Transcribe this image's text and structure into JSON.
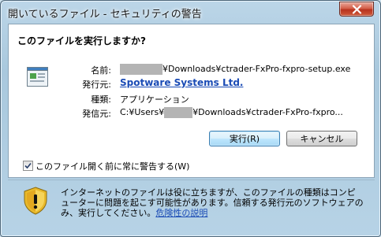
{
  "window": {
    "title": "開いているファイル - セキュリティの警告",
    "close_icon": "close-x-icon"
  },
  "dialog": {
    "question": "このファイルを実行しますか?",
    "file_icon": "executable-file-icon",
    "details": {
      "name_label": "名前:",
      "name_value": "¥Downloads¥ctrader-FxPro-fxpro-setup.exe",
      "publisher_label": "発行元:",
      "publisher_value": "Spotware Systems Ltd.",
      "type_label": "種類:",
      "type_value": "アプリケーション",
      "from_label": "発信元:",
      "from_prefix": "C:¥Users¥",
      "from_suffix": "¥Downloads¥ctrader-FxPro-fxpro..."
    },
    "buttons": {
      "run": "実行(R)",
      "cancel": "キャンセル"
    },
    "checkbox": {
      "label": "このファイル開く前に常に警告する(W)",
      "checked": true
    },
    "warning": {
      "icon": "shield-warning-icon",
      "text": "インターネットのファイルは役に立ちますが、このファイルの種類はコンピューターに問題を起こす可能性があります。信頼する発行元のソフトウェアのみ、実行してください。",
      "link": "危険性の説明"
    }
  },
  "colors": {
    "link": "#1a4bb5",
    "frame": "#a9c8dd",
    "close": "#c8452e"
  }
}
